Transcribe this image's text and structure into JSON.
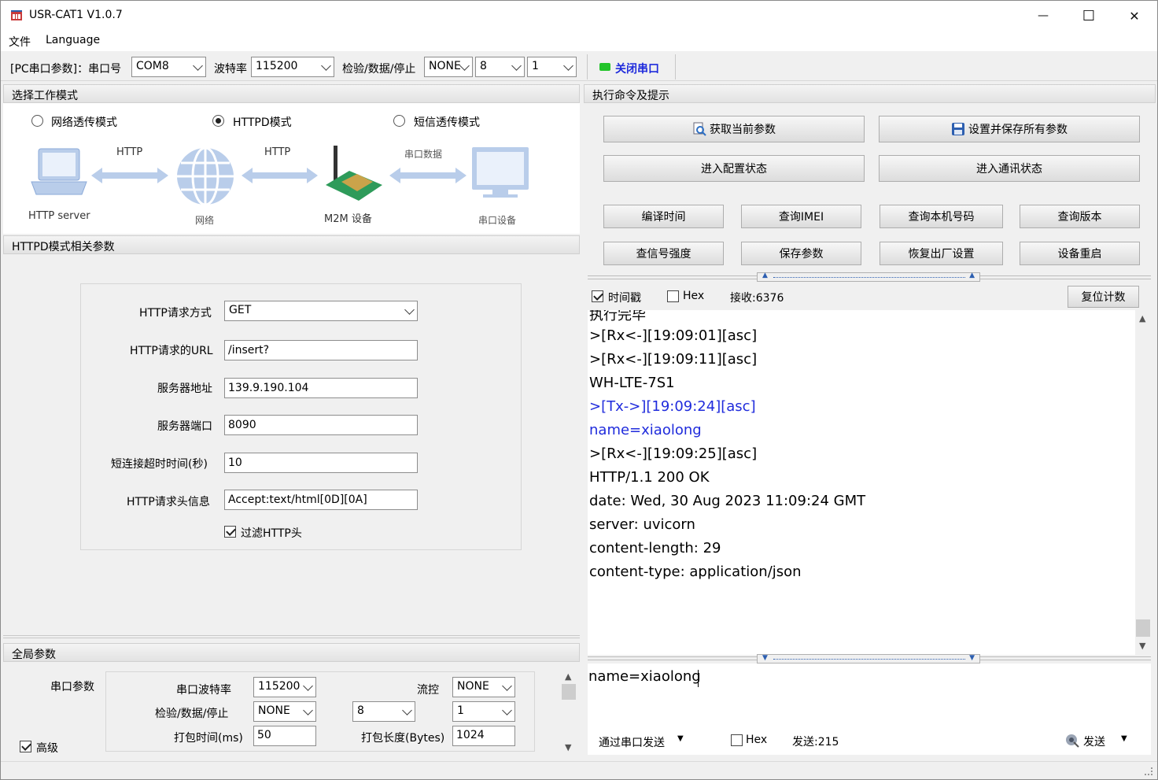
{
  "window": {
    "title": "USR-CAT1 V1.0.7",
    "minimize": "—",
    "maximize": "☐",
    "close": "✕"
  },
  "menu": {
    "file": "文件",
    "language": "Language"
  },
  "serial": {
    "label": "[PC串口参数]：串口号",
    "port": "COM8",
    "baud_label": "波特率",
    "baud": "115200",
    "parity_label": "检验/数据/停止",
    "parity": "NONE",
    "databits": "8",
    "stopbits": "1",
    "close_port": "关闭串口"
  },
  "mode": {
    "header": "选择工作模式",
    "options": [
      "网络透传模式",
      "HTTPD模式",
      "短信透传模式"
    ],
    "selected": "HTTPD模式",
    "diagram": {
      "server_label": "HTTP server",
      "link1": "HTTP",
      "network_label": "网络",
      "link2": "HTTP",
      "m2m_label": "M2M 设备",
      "link3": "串口数据",
      "serial_device_label": "串口设备"
    }
  },
  "httpd": {
    "header": "HTTPD模式相关参数",
    "method_label": "HTTP请求方式",
    "method": "GET",
    "url_label": "HTTP请求的URL",
    "url": "/insert?",
    "server_label": "服务器地址",
    "server": "139.9.190.104",
    "port_label": "服务器端口",
    "port": "8090",
    "timeout_label": "短连接超时时间(秒)",
    "timeout": "10",
    "header_label": "HTTP请求头信息",
    "header_value": "Accept:text/html[0D][0A]",
    "filter_label": "过滤HTTP头",
    "filter_checked": true
  },
  "global": {
    "header": "全局参数",
    "serial_params_label": "串口参数",
    "baud_label": "串口波特率",
    "baud": "115200",
    "flow_label": "流控",
    "flow": "NONE",
    "parity_label": "检验/数据/停止",
    "parity": "NONE",
    "databits": "8",
    "stopbits": "1",
    "pack_time_label": "打包时间(ms)",
    "pack_time": "50",
    "pack_len_label": "打包长度(Bytes)",
    "pack_len": "1024",
    "advanced_label": "高级",
    "advanced_checked": true
  },
  "commands": {
    "header": "执行命令及提示",
    "get_params": "获取当前参数",
    "set_save_all": "设置并保存所有参数",
    "enter_config": "进入配置状态",
    "enter_comm": "进入通讯状态",
    "compile_time": "编译时间",
    "query_imei": "查询IMEI",
    "query_number": "查询本机号码",
    "query_version": "查询版本",
    "query_signal": "查信号强度",
    "save_params": "保存参数",
    "factory_reset": "恢复出厂设置",
    "reboot": "设备重启"
  },
  "receive": {
    "timestamp_label": "时间戳",
    "timestamp_checked": true,
    "hex_label": "Hex",
    "hex_checked": false,
    "count_label": "接收:6376",
    "reset_button": "复位计数",
    "lines": [
      {
        "text": "执行完毕",
        "color": "black"
      },
      {
        "text": ">[Rx<-][19:09:01][asc]",
        "color": "black"
      },
      {
        "text": ">[Rx<-][19:09:11][asc]",
        "color": "black"
      },
      {
        "text": "WH-LTE-7S1",
        "color": "black"
      },
      {
        "text": ">[Tx->][19:09:24][asc]",
        "color": "blue"
      },
      {
        "text": "name=xiaolong",
        "color": "blue"
      },
      {
        "text": ">[Rx<-][19:09:25][asc]",
        "color": "black"
      },
      {
        "text": "HTTP/1.1 200 OK",
        "color": "black"
      },
      {
        "text": "date: Wed, 30 Aug 2023 11:09:24 GMT",
        "color": "black"
      },
      {
        "text": "server: uvicorn",
        "color": "black"
      },
      {
        "text": "content-length: 29",
        "color": "black"
      },
      {
        "text": "content-type: application/json",
        "color": "black"
      }
    ]
  },
  "send": {
    "text": "name=xiaolong",
    "via_label": "通过串口发送",
    "hex_label": "Hex",
    "hex_checked": false,
    "count_label": "发送:215",
    "send_button": "发送"
  }
}
